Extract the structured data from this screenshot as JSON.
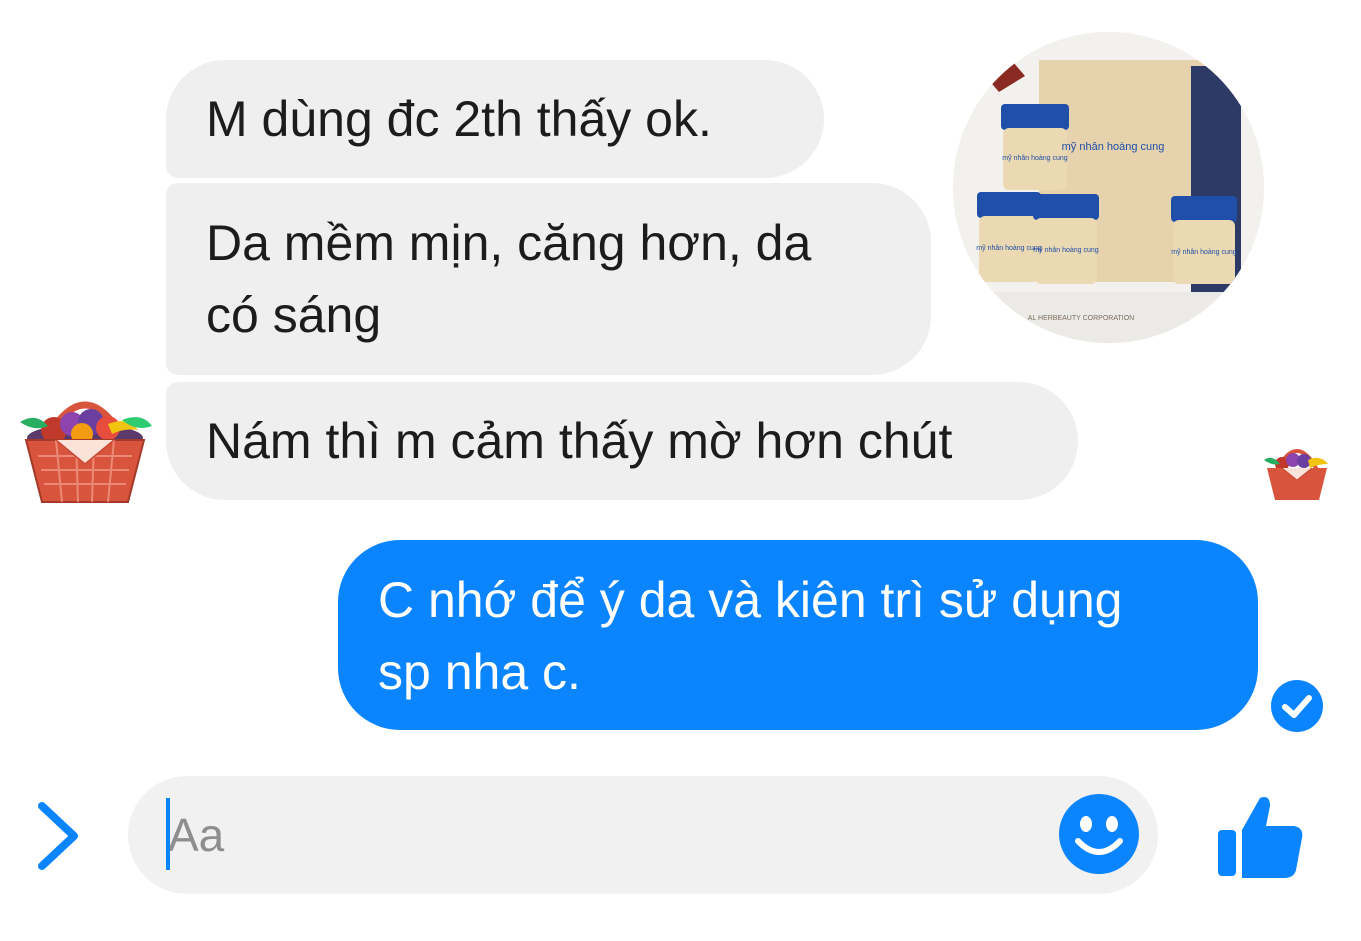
{
  "messages": {
    "received": [
      "M dùng đc 2th thấy ok.",
      "Da mềm mịn, căng hơn, da\ncó sáng",
      "Nám thì m cảm thấy mờ hơn chút"
    ],
    "sent": [
      "C nhớ để ý da và kiên trì sử dụng\nsp nha c."
    ]
  },
  "product_photo": {
    "jar_label": "mỹ nhân hoàng cung",
    "footer_text": "AL HERBEAUTY CORPORATION"
  },
  "composer": {
    "placeholder": "Aa"
  },
  "icons": {
    "expand": "chevron-right-icon",
    "emoji": "smiley-icon",
    "like": "thumbs-up-icon",
    "seen": "check-circle-icon",
    "avatar": "fruit-basket-avatar"
  },
  "colors": {
    "accent": "#0a84ff",
    "received_bubble": "#efefef",
    "sent_bubble": "#0a84ff",
    "composer_bg": "#f1f1f1"
  }
}
